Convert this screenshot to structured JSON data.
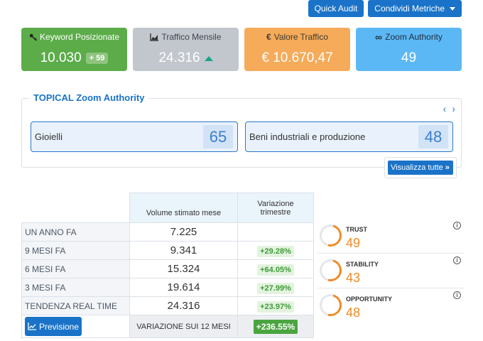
{
  "toolbar": {
    "quick_audit": "Quick Audit",
    "share_metrics": "Condividi Metriche"
  },
  "cards": [
    {
      "title": "Keyword Posizionate",
      "icon": "key-icon",
      "value": "10.030",
      "delta": "+ 59",
      "color": "#5cac4a"
    },
    {
      "title": "Traffico Mensile",
      "icon": "area-chart-icon",
      "value": "24.316",
      "trend": "up",
      "color": "#c2c6cd"
    },
    {
      "title": "Valore Traffico",
      "icon": "euro-icon",
      "value": "€ 10.670,47",
      "color": "#f6ab5a"
    },
    {
      "title": "Zoom Authority",
      "icon": "infinity-icon",
      "value": "49",
      "color": "#5cb8f5"
    }
  ],
  "topical": {
    "title": "TOPICAL Zoom Authority",
    "categories": [
      {
        "name": "Gioielli",
        "score": "65"
      },
      {
        "name": "Beni industriali e produzione",
        "score": "48"
      }
    ],
    "view_all": "Visualizza tutte"
  },
  "history": {
    "headers": {
      "volume": "Volume stimato mese",
      "variation": "Variazione trimestre"
    },
    "rows": [
      {
        "label": "UN ANNO FA",
        "volume": "7.225",
        "variation": ""
      },
      {
        "label": "9 MESI FA",
        "volume": "9.341",
        "variation": "+29.28%"
      },
      {
        "label": "6 MESI FA",
        "volume": "15.324",
        "variation": "+64.05%"
      },
      {
        "label": "3 MESI FA",
        "volume": "19.614",
        "variation": "+27.99%"
      },
      {
        "label": "TENDENZA REAL TIME",
        "volume": "24.316",
        "variation": "+23.97%"
      }
    ],
    "forecast_button": "Previsione",
    "yearly_label": "VARIAZIONE SUI 12 MESI",
    "yearly_value": "+236.55%"
  },
  "metrics": [
    {
      "label": "TRUST",
      "value": "49"
    },
    {
      "label": "STABILITY",
      "value": "43"
    },
    {
      "label": "OPPORTUNITY",
      "value": "48"
    }
  ],
  "colors": {
    "accent": "#1a73c8",
    "metric": "#f08b25",
    "positive": "#4aa540"
  }
}
